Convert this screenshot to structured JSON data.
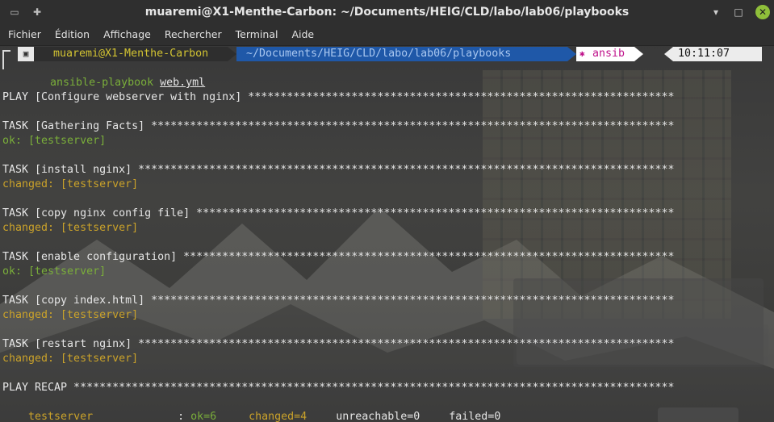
{
  "window": {
    "title": "muaremi@X1-Menthe-Carbon: ~/Documents/HEIG/CLD/labo/lab06/playbooks",
    "controls": {
      "minimize": "▾",
      "maximize": "□",
      "close": "✕"
    }
  },
  "menu": [
    "Fichier",
    "Édition",
    "Affichage",
    "Rechercher",
    "Terminal",
    "Aide"
  ],
  "prompt": {
    "user_host": "muaremi@X1-Menthe-Carbon",
    "path": "~/Documents/HEIG/CLD/labo/lab06/playbooks",
    "git": "ansib",
    "time": "10:11:07",
    "command": "ansible-playbook",
    "argument": "web.yml"
  },
  "output": [
    {
      "text": "PLAY [Configure webserver with nginx] ******************************************************************",
      "style": "default"
    },
    {
      "text": "",
      "style": "default"
    },
    {
      "text": "TASK [Gathering Facts] *********************************************************************************",
      "style": "default"
    },
    {
      "text": "ok: [testserver]",
      "style": "green"
    },
    {
      "text": "",
      "style": "default"
    },
    {
      "text": "TASK [install nginx] ***********************************************************************************",
      "style": "default"
    },
    {
      "text": "changed: [testserver]",
      "style": "orange"
    },
    {
      "text": "",
      "style": "default"
    },
    {
      "text": "TASK [copy nginx config file] **************************************************************************",
      "style": "default"
    },
    {
      "text": "changed: [testserver]",
      "style": "orange"
    },
    {
      "text": "",
      "style": "default"
    },
    {
      "text": "TASK [enable configuration] ****************************************************************************",
      "style": "default"
    },
    {
      "text": "ok: [testserver]",
      "style": "green"
    },
    {
      "text": "",
      "style": "default"
    },
    {
      "text": "TASK [copy index.html] *********************************************************************************",
      "style": "default"
    },
    {
      "text": "changed: [testserver]",
      "style": "orange"
    },
    {
      "text": "",
      "style": "default"
    },
    {
      "text": "TASK [restart nginx] ***********************************************************************************",
      "style": "default"
    },
    {
      "text": "changed: [testserver]",
      "style": "orange"
    },
    {
      "text": "",
      "style": "default"
    },
    {
      "text": "PLAY RECAP *********************************************************************************************",
      "style": "default"
    }
  ],
  "recap": {
    "host": "testserver",
    "sep": ": ",
    "ok": "ok=6",
    "changed": "changed=4",
    "unreachable": "unreachable=0",
    "failed": "failed=0"
  }
}
